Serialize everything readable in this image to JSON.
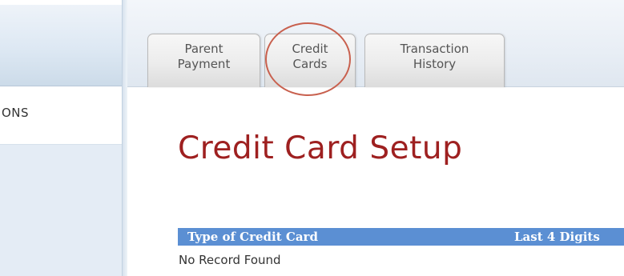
{
  "sidebar": {
    "item_label": "ONS"
  },
  "tabs": [
    {
      "label": "Parent\nPayment",
      "active": false
    },
    {
      "label": "Credit\nCards",
      "active": true
    },
    {
      "label": "Transaction\nHistory",
      "active": false
    }
  ],
  "main": {
    "title": "Credit Card Setup",
    "table": {
      "columns": [
        "Type of Credit Card",
        "Last 4 Digits"
      ],
      "empty_message": "No Record Found"
    }
  },
  "colors": {
    "title": "#9e2020",
    "table_header": "#5b8fd3",
    "highlight_circle": "#c8604e"
  }
}
